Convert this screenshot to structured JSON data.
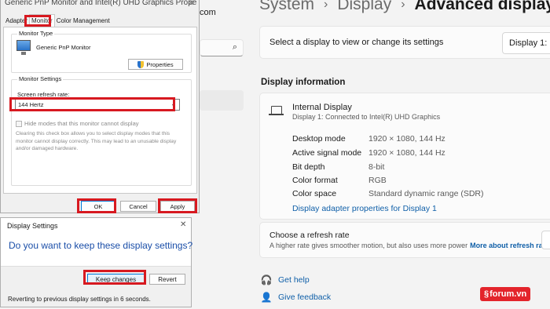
{
  "settings": {
    "breadcrumb": [
      "System",
      "Display",
      "Advanced display"
    ],
    "select_display_text": "Select a display to view or change its settings",
    "display_dropdown": "Display 1: Inte",
    "display_info_title": "Display information",
    "display_name": "Internal Display",
    "display_sub": "Display 1: Connected to Intel(R) UHD Graphics",
    "rows": [
      {
        "label": "Desktop mode",
        "value": "1920 × 1080, 144 Hz"
      },
      {
        "label": "Active signal mode",
        "value": "1920 × 1080, 144 Hz"
      },
      {
        "label": "Bit depth",
        "value": "8-bit"
      },
      {
        "label": "Color format",
        "value": "RGB"
      },
      {
        "label": "Color space",
        "value": "Standard dynamic range (SDR)"
      }
    ],
    "adapter_link": "Display adapter properties for Display 1",
    "refresh_title": "Choose a refresh rate",
    "refresh_desc": "A higher rate gives smoother motion, but also uses more power",
    "refresh_more": "More about refresh rate",
    "get_help": "Get help",
    "give_feedback": "Give feedback",
    "partial_text": "com"
  },
  "props_dialog": {
    "title": "Generic PnP Monitor and Intel(R) UHD Graphics Properties",
    "tabs": [
      "Adapter",
      "Monitor",
      "Color Management"
    ],
    "monitor_type_label": "Monitor Type",
    "monitor_name": "Generic PnP Monitor",
    "properties_button": "Properties",
    "monitor_settings_label": "Monitor Settings",
    "refresh_rate_label": "Screen refresh rate:",
    "refresh_rate_value": "144 Hertz",
    "hide_modes_label": "Hide modes that this monitor cannot display",
    "warning_text": "Clearing this check box allows you to select display modes that this monitor cannot display correctly. This may lead to an unusable display and/or damaged hardware.",
    "ok": "OK",
    "cancel": "Cancel",
    "apply": "Apply"
  },
  "keep_dialog": {
    "title": "Display Settings",
    "question": "Do you want to keep these display settings?",
    "keep_button": "Keep changes",
    "revert_button": "Revert",
    "countdown_text": "Reverting to previous display settings in 6 seconds."
  },
  "watermark": "forum.vn",
  "colors": {
    "highlight": "#d71920",
    "link": "#0f5fa8",
    "watermark_bg": "#e3242b"
  }
}
